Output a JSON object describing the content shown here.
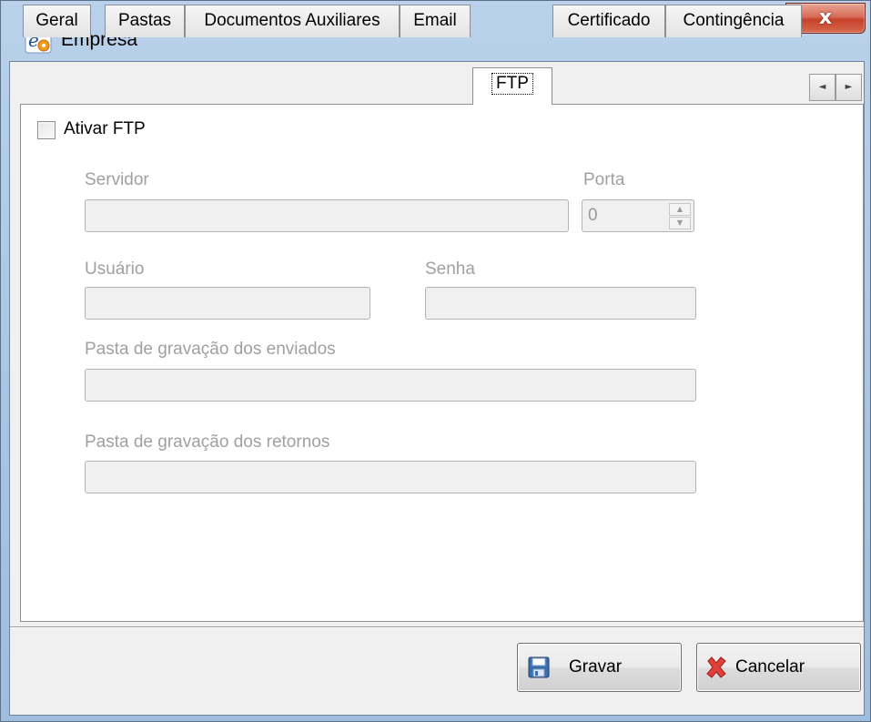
{
  "window": {
    "title": "Empresa",
    "close_glyph": "x",
    "app_icon": "empresa-app-icon"
  },
  "tabs": [
    {
      "label": "Geral",
      "active": false
    },
    {
      "label": "Pastas",
      "active": false
    },
    {
      "label": "Documentos Auxiliares",
      "active": false
    },
    {
      "label": "Email",
      "active": false
    },
    {
      "label": "FTP",
      "active": true
    },
    {
      "label": "Certificado",
      "active": false
    },
    {
      "label": "Contingência",
      "active": false
    }
  ],
  "tab_scroll": {
    "left": "◄",
    "right": "►"
  },
  "ftp": {
    "enable_label": "Ativar FTP",
    "enable_checked": false,
    "server": {
      "label": "Servidor",
      "value": ""
    },
    "port": {
      "label": "Porta",
      "value": "0"
    },
    "user": {
      "label": "Usuário",
      "value": ""
    },
    "password": {
      "label": "Senha",
      "value": ""
    },
    "sent_folder": {
      "label": "Pasta de gravação dos enviados",
      "value": ""
    },
    "returns_folder": {
      "label": "Pasta de gravação dos retornos",
      "value": ""
    }
  },
  "buttons": {
    "save": {
      "label": "Gravar",
      "icon": "floppy-disk-icon"
    },
    "cancel": {
      "label": "Cancelar",
      "icon": "red-x-icon"
    }
  },
  "colors": {
    "titlebar": "#b9d1ea",
    "close": "#c7412a",
    "disabled_text": "#a0a0a0",
    "field_bg": "#f0f0f0"
  }
}
